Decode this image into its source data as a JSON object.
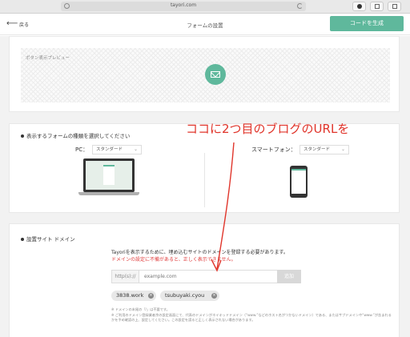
{
  "browser": {
    "url": "tayori.com"
  },
  "header": {
    "back_label": "戻る",
    "title": "フォームの設置",
    "generate_button": "コードを生成"
  },
  "preview": {
    "label": "ボタン表示プレビュー"
  },
  "form_type": {
    "title": "表示するフォームの種類を選択してください",
    "pc_label": "PC：",
    "pc_value": "スタンダード",
    "sp_label": "スマートフォン：",
    "sp_value": "スタンダード"
  },
  "domain": {
    "title": "設置サイト ドメイン",
    "desc1": "Tayoriを表示するために、埋め込むサイトのドメインを登録する必要があります。",
    "desc2": "ドメインの設定に不備があると、正しく表示できません。",
    "prefix": "http(s)://",
    "placeholder": "example.com",
    "add_label": "追加",
    "tags": [
      "3838.work",
      "tsubuyaki.cyou"
    ],
    "note1": "※ ドメインの末尾の「/」は不要です。",
    "note2": "※ ご利用のドメイン登録業者余の設定画面にて、代表のドメインがネイキッドドメイン（“www.”などのホスト名がつかないドメイン）である、またはサブドメインや“www.”が含まれるかを予め確認の上、設定してください。この設定を誤ると正しく表示されない場合があります。"
  },
  "annotation": {
    "text": "ココに2つ目のブログのURLを"
  },
  "colors": {
    "accent": "#5fb89c",
    "annotation": "#e0352b"
  }
}
